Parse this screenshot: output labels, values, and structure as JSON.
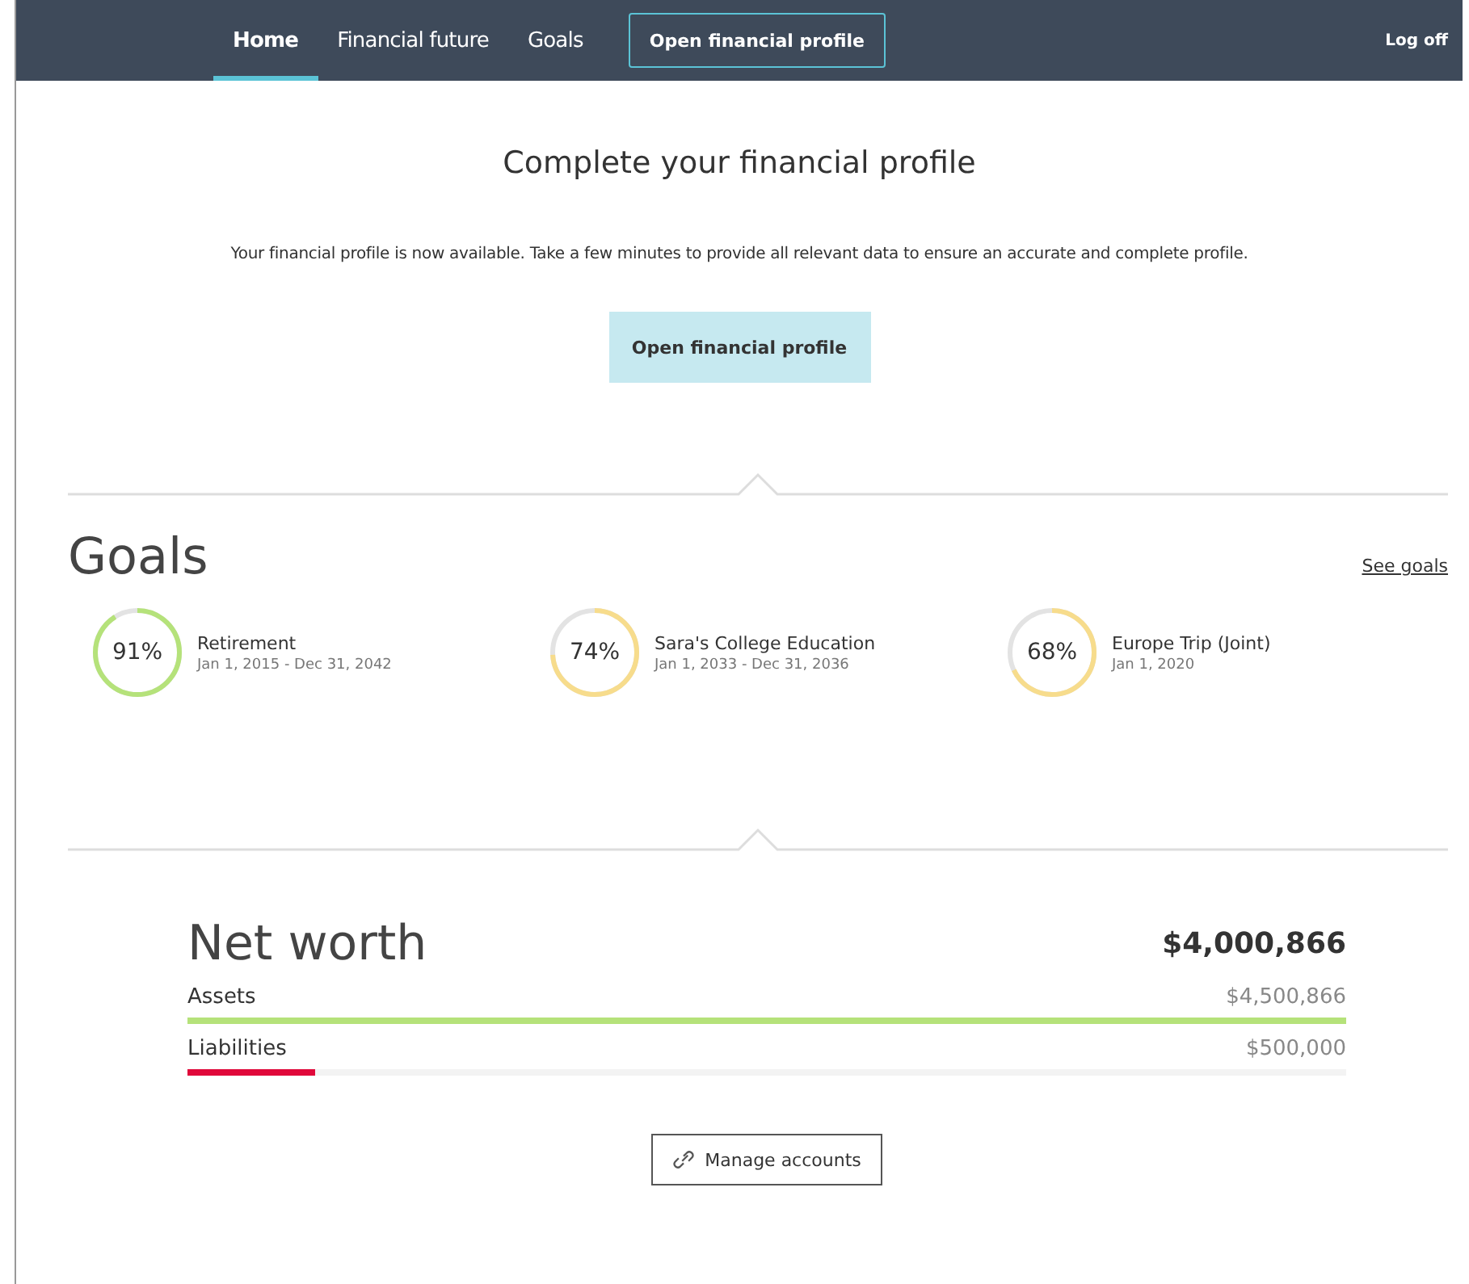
{
  "nav": {
    "items": [
      {
        "label": "Home",
        "selected": true
      },
      {
        "label": "Financial future",
        "selected": false
      },
      {
        "label": "Goals",
        "selected": false
      }
    ],
    "profile_button": "Open financial profile",
    "log_off": "Log off"
  },
  "profile": {
    "title": "Complete your financial profile",
    "message": "Your financial profile is now available. Take a few minutes to provide all relevant data to ensure an accurate and complete profile.",
    "button": "Open financial profile"
  },
  "goals": {
    "title": "Goals",
    "link": "See goals",
    "items": [
      {
        "percent": "91%",
        "level": 0.91,
        "color": "#b5e27a",
        "name": "Retirement",
        "dates": "Jan 1, 2015 - Dec 31, 2042"
      },
      {
        "percent": "74%",
        "level": 0.74,
        "color": "#f7dc8c",
        "name": "Sara's College Education",
        "dates": "Jan 1, 2033 - Dec 31, 2036"
      },
      {
        "percent": "68%",
        "level": 0.68,
        "color": "#f7dc8c",
        "name": "Europe Trip (Joint)",
        "dates": "Jan 1, 2020"
      }
    ]
  },
  "net_worth": {
    "title": "Net worth",
    "total": "$4,000,866",
    "rows": [
      {
        "label": "Assets",
        "amount": "$4,500,866",
        "level": 1,
        "color": "#b5e27a"
      },
      {
        "label": "Liabilities",
        "amount": "$500,000",
        "level": 0.11,
        "color": "#e0083a"
      }
    ],
    "button": "Manage accounts"
  }
}
